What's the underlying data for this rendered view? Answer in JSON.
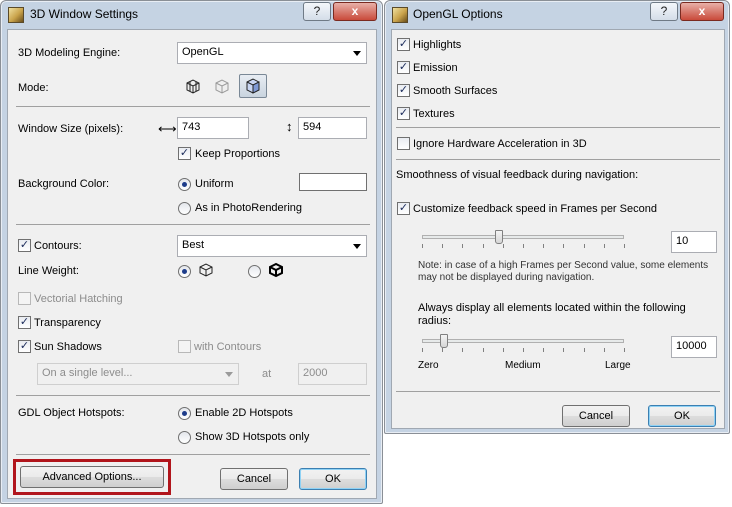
{
  "colors": {
    "highlight": "#b1151c",
    "titlebar": "#c5d3e3",
    "accent_check": "#1a2a5a"
  },
  "settings_window": {
    "title": "3D Window Settings",
    "help_button": "?",
    "close_button": "x",
    "engine": {
      "label": "3D Modeling Engine:",
      "value": "OpenGL"
    },
    "mode": {
      "label": "Mode:",
      "icons": [
        "wireframe-mode-icon",
        "hidden-line-mode-icon",
        "shading-mode-icon"
      ],
      "selected": "shading-mode-icon"
    },
    "window_size": {
      "label": "Window Size (pixels):",
      "width": "743",
      "height": "594",
      "keep_proportions": "Keep Proportions",
      "keep_checked": true
    },
    "background": {
      "label": "Background Color:",
      "uniform": "Uniform",
      "photorendering": "As in PhotoRendering",
      "selected": "uniform",
      "swatch": "#ffffff"
    },
    "contours": {
      "label": "Contours:",
      "checked": true,
      "value": "Best"
    },
    "line_weight": {
      "label": "Line Weight:"
    },
    "vectorial_hatching": {
      "label": "Vectorial Hatching",
      "checked": false
    },
    "transparency": {
      "label": "Transparency",
      "checked": true
    },
    "sun_shadows": {
      "label": "Sun Shadows",
      "checked": true,
      "with_contours": "with Contours",
      "level_select": "On a single level...",
      "at_label": "at",
      "at_value": "2000"
    },
    "gdl": {
      "label": "GDL Object Hotspots:",
      "enable_2d": "Enable 2D Hotspots",
      "show_3d": "Show 3D Hotspots only",
      "selected": "enable_2d"
    },
    "advanced_button": "Advanced Options...",
    "cancel_button": "Cancel",
    "ok_button": "OK"
  },
  "opengl_window": {
    "title": "OpenGL Options",
    "help_button": "?",
    "close_button": "x",
    "highlights": {
      "label": "Highlights",
      "checked": true
    },
    "emission": {
      "label": "Emission",
      "checked": true
    },
    "smooth_surfaces": {
      "label": "Smooth Surfaces",
      "checked": true
    },
    "textures": {
      "label": "Textures",
      "checked": true
    },
    "ignore_hw": {
      "label": "Ignore Hardware Acceleration in 3D",
      "checked": false
    },
    "smoothness_label": "Smoothness of visual feedback during navigation:",
    "customize": {
      "label": "Customize feedback speed in Frames per Second",
      "checked": true
    },
    "fps_value": "10",
    "fps_slider_fraction": 0.38,
    "note": "Note: in case of a high Frames per Second value, some elements may not be displayed during navigation.",
    "radius_label": "Always display all elements located within the following radius:",
    "radius_value": "10000",
    "radius_slider_fraction": 0.11,
    "scale": {
      "zero": "Zero",
      "medium": "Medium",
      "large": "Large"
    },
    "cancel_button": "Cancel",
    "ok_button": "OK"
  },
  "check_glyph": "✓"
}
